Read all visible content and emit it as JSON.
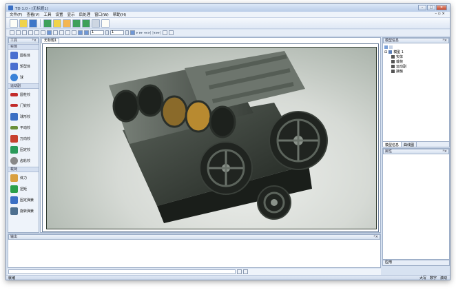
{
  "window": {
    "title": "TD 1.0 - [无标题1]",
    "controls": [
      "–",
      "□",
      "✕"
    ],
    "mdi_controls": "– ▫ ×"
  },
  "menu": [
    "文件(F)",
    "查看(V)",
    "工具",
    "设置",
    "显示",
    "后处理",
    "窗口(W)",
    "帮助(H)"
  ],
  "toolbar2": {
    "spin1": "1",
    "spin2": "1"
  },
  "toolbox": {
    "title": "工具",
    "groups": [
      {
        "label": "实体",
        "items": [
          {
            "label": "圆柱体",
            "color": "#4a6fd0"
          },
          {
            "label": "矩型体",
            "color": "#4a6fd0"
          },
          {
            "label": "球",
            "color": "#3a82d8"
          }
        ]
      },
      {
        "label": "运动副",
        "items": [
          {
            "label": "圆柱铰",
            "color": "#c22b2b"
          },
          {
            "label": "门铰铰",
            "color": "#c22b2b"
          },
          {
            "label": "球形铰",
            "color": "#3a6fc4"
          },
          {
            "label": "平动铰",
            "color": "#6a8f3a"
          },
          {
            "label": "万向铰",
            "color": "#c8402e"
          },
          {
            "label": "固定铰",
            "color": "#2a9a5a"
          },
          {
            "label": "齿轮铰",
            "color": "#888888"
          }
        ]
      },
      {
        "label": "载荷",
        "items": [
          {
            "label": "体力",
            "color": "#d9a040"
          },
          {
            "label": "扭矩",
            "color": "#2aa04a"
          },
          {
            "label": "固定弹簧",
            "color": "#3a6fc4"
          },
          {
            "label": "旋转弹簧",
            "color": "#4d6f8f"
          }
        ]
      }
    ]
  },
  "document": {
    "tab": "无标题1"
  },
  "tree_panel": {
    "title": "模型信息",
    "root": "模型 1",
    "children": [
      "实体",
      "载荷",
      "运动副",
      "接触"
    ]
  },
  "right_tabs": [
    "模型信息",
    "曲线图"
  ],
  "props_panel": {
    "title": "属性",
    "footer": "应用"
  },
  "output": {
    "title": "输出"
  },
  "status": {
    "left": "就绪",
    "right": [
      "大写",
      "数字",
      "滚动"
    ]
  }
}
